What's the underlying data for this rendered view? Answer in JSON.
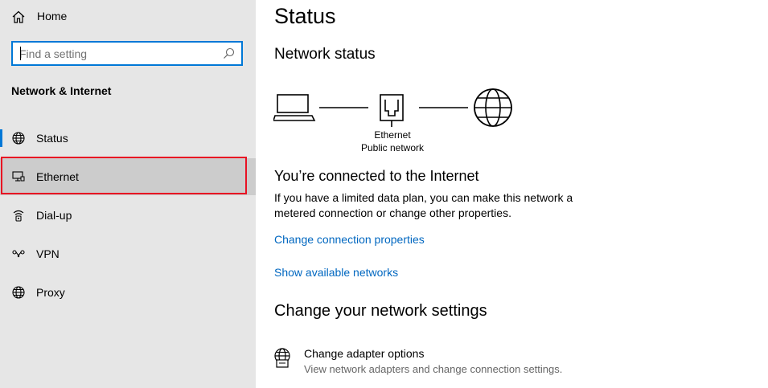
{
  "sidebar": {
    "home_label": "Home",
    "search": {
      "placeholder": "Find a setting",
      "value": ""
    },
    "section_title": "Network & Internet",
    "items": [
      {
        "label": "Status",
        "icon": "globe-icon"
      },
      {
        "label": "Ethernet",
        "icon": "ethernet-icon"
      },
      {
        "label": "Dial-up",
        "icon": "dial-up-icon"
      },
      {
        "label": "VPN",
        "icon": "vpn-icon"
      },
      {
        "label": "Proxy",
        "icon": "globe-icon"
      }
    ]
  },
  "main": {
    "title": "Status",
    "network_status_title": "Network status",
    "diagram": {
      "adapter_name": "Ethernet",
      "network_type": "Public network"
    },
    "connection": {
      "title": "You’re connected to the Internet",
      "description": "If you have a limited data plan, you can make this network a metered connection or change other properties."
    },
    "links": {
      "change_properties": "Change connection properties",
      "show_networks": "Show available networks"
    },
    "change_settings_title": "Change your network settings",
    "adapter_options": {
      "title": "Change adapter options",
      "description": "View network adapters and change connection settings."
    }
  },
  "colors": {
    "accent": "#0078d7",
    "link": "#0067c0",
    "highlight_border": "#e81123",
    "sidebar_bg": "#e6e6e6",
    "hover_bg": "#cccccc"
  }
}
